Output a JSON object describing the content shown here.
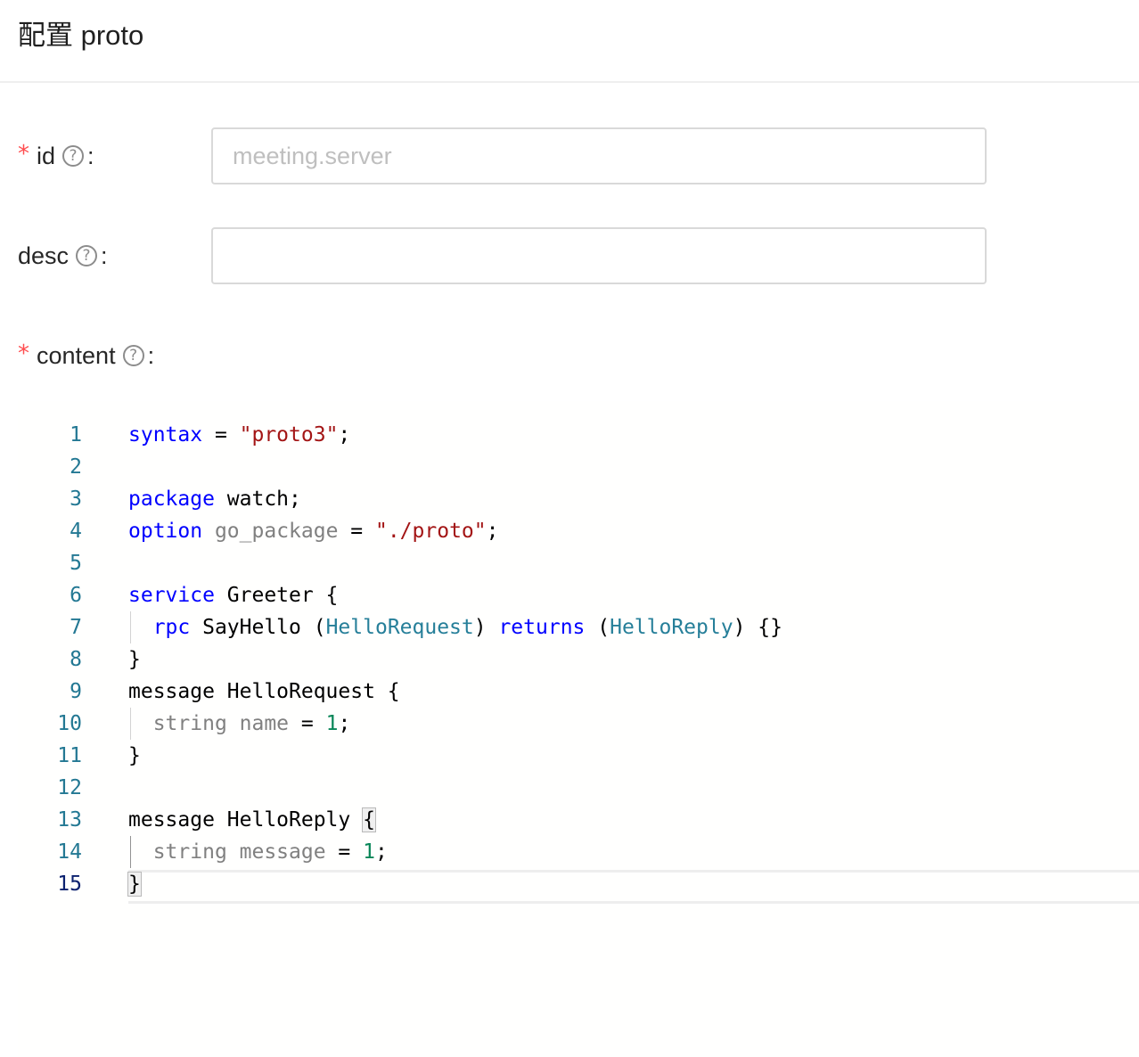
{
  "header": {
    "title": "配置 proto"
  },
  "form": {
    "id": {
      "label": "id",
      "required": true,
      "help_glyph": "?",
      "colon": ":",
      "value": "",
      "placeholder": "meeting.server"
    },
    "desc": {
      "label": "desc",
      "required": false,
      "help_glyph": "?",
      "colon": ":",
      "value": "",
      "placeholder": ""
    },
    "content": {
      "label": "content",
      "required": true,
      "help_glyph": "?",
      "colon": ":"
    },
    "required_mark": "*"
  },
  "editor": {
    "line_numbers": [
      "1",
      "2",
      "3",
      "4",
      "5",
      "6",
      "7",
      "8",
      "9",
      "10",
      "11",
      "12",
      "13",
      "14",
      "15"
    ],
    "active_line": 15,
    "lines": [
      {
        "tokens": [
          {
            "t": "syntax",
            "c": "kw"
          },
          {
            "t": " = "
          },
          {
            "t": "\"proto3\"",
            "c": "str"
          },
          {
            "t": ";"
          }
        ]
      },
      {
        "tokens": []
      },
      {
        "tokens": [
          {
            "t": "package",
            "c": "kw"
          },
          {
            "t": " watch;"
          }
        ]
      },
      {
        "tokens": [
          {
            "t": "option",
            "c": "kw"
          },
          {
            "t": " "
          },
          {
            "t": "go_package",
            "c": "muted"
          },
          {
            "t": " = "
          },
          {
            "t": "\"./proto\"",
            "c": "str"
          },
          {
            "t": ";"
          }
        ]
      },
      {
        "tokens": []
      },
      {
        "tokens": [
          {
            "t": "service",
            "c": "kw"
          },
          {
            "t": " Greeter {"
          }
        ]
      },
      {
        "indent": true,
        "tokens": [
          {
            "t": "  "
          },
          {
            "t": "rpc",
            "c": "kw"
          },
          {
            "t": " SayHello ("
          },
          {
            "t": "HelloRequest",
            "c": "type"
          },
          {
            "t": ") "
          },
          {
            "t": "returns",
            "c": "kw"
          },
          {
            "t": " ("
          },
          {
            "t": "HelloReply",
            "c": "type"
          },
          {
            "t": ") {}"
          }
        ]
      },
      {
        "tokens": [
          {
            "t": "}"
          }
        ]
      },
      {
        "tokens": [
          {
            "t": "message HelloRequest {"
          }
        ]
      },
      {
        "indent": true,
        "tokens": [
          {
            "t": "  "
          },
          {
            "t": "string name",
            "c": "muted"
          },
          {
            "t": " = "
          },
          {
            "t": "1",
            "c": "num"
          },
          {
            "t": ";"
          }
        ]
      },
      {
        "tokens": [
          {
            "t": "}"
          }
        ]
      },
      {
        "tokens": []
      },
      {
        "tokens": [
          {
            "t": "message HelloReply "
          },
          {
            "t": "{",
            "c": "match"
          }
        ]
      },
      {
        "indent": true,
        "indent_active": true,
        "tokens": [
          {
            "t": "  "
          },
          {
            "t": "string message",
            "c": "muted"
          },
          {
            "t": " = "
          },
          {
            "t": "1",
            "c": "num"
          },
          {
            "t": ";"
          }
        ]
      },
      {
        "tokens": [
          {
            "t": "}",
            "c": "match"
          }
        ]
      }
    ]
  }
}
